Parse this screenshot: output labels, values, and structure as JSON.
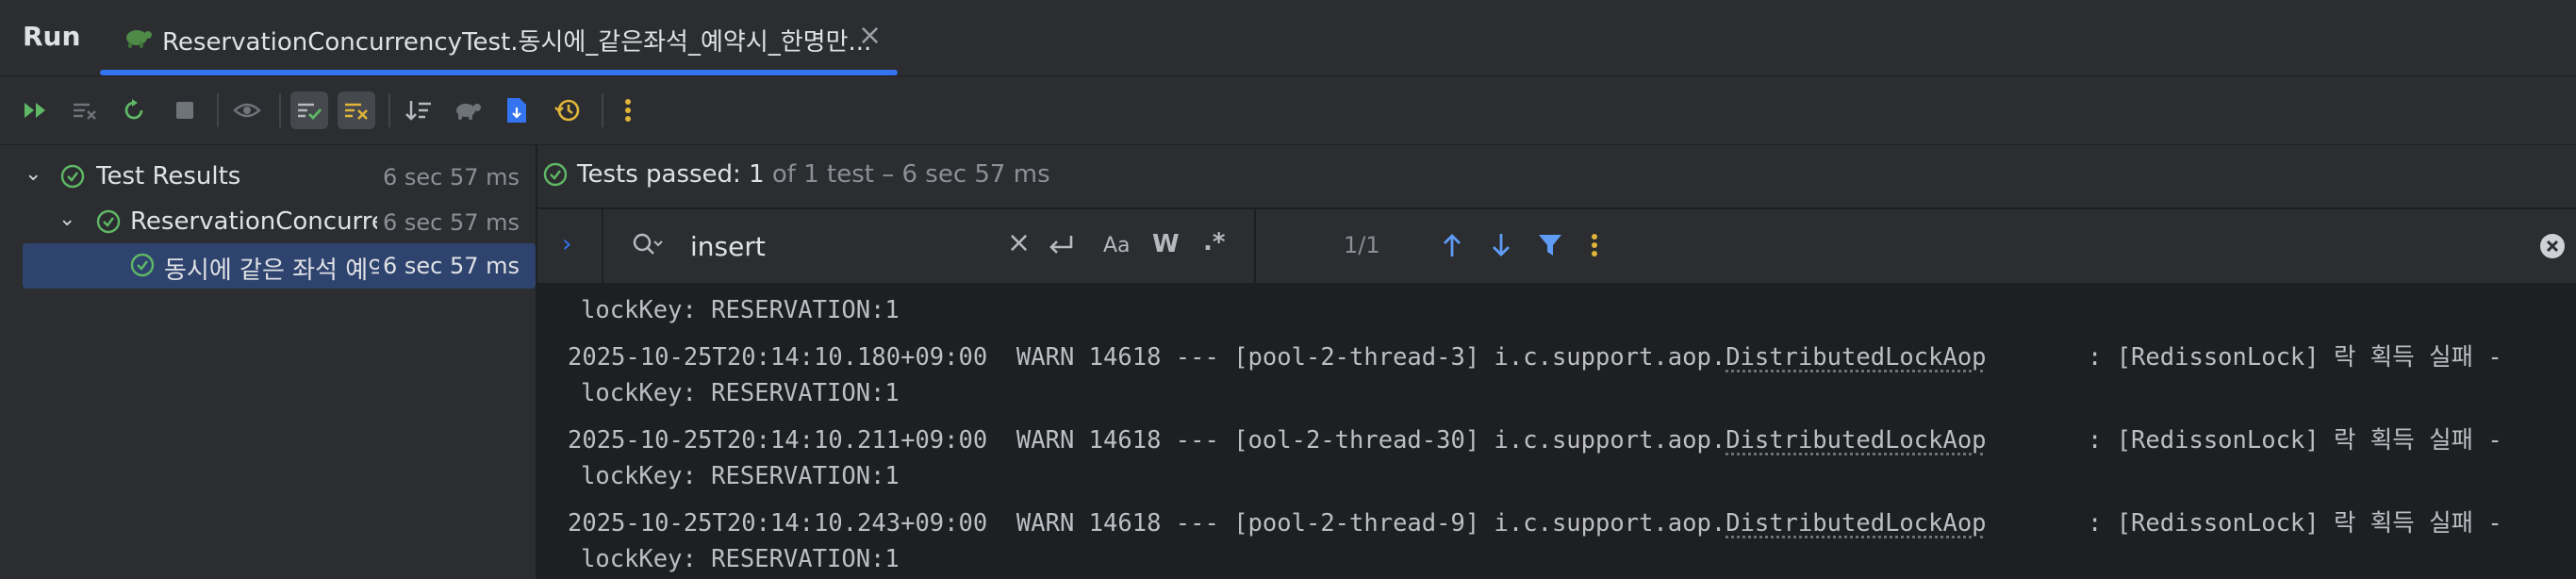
{
  "header": {
    "run_label": "Run",
    "tab_title": "ReservationConcurrencyTest.동시에_같은좌석_예약시_한명만...",
    "tab_close": "×"
  },
  "toolbar": {
    "buttons": [
      "rerun-failed-icon",
      "rerun-tests-icon",
      "toggle-auto-test-icon",
      "stop-icon",
      "show-passed-icon",
      "show-ignored-icon",
      "sort-icon",
      "collapse-icon",
      "export-icon",
      "history-icon",
      "more-icon"
    ]
  },
  "tree": {
    "root": {
      "label": "Test Results",
      "time": "6 sec 57 ms"
    },
    "class_node": {
      "label": "ReservationConcurrencyTest",
      "time": "6 sec 57 ms"
    },
    "method_node": {
      "label": "동시에 같은 좌석 예약시 한명만",
      "time": "6 sec 57 ms"
    }
  },
  "status": {
    "prefix": "Tests passed: ",
    "count": "1",
    "suffix": " of 1 test – 6 sec 57 ms"
  },
  "search": {
    "value": "insert",
    "clear": "×",
    "match_case": "Aa",
    "words": "W",
    "regex": ".*",
    "counter": "1/1"
  },
  "console": {
    "lines": [
      {
        "cont": true,
        "text": "lockKey: RESERVATION:1"
      },
      {
        "cont": false,
        "pre": "2025-10-25T20:14:10.180+09:00  WARN 14618 --- [pool-2-thread-3] i.c.support.aop.",
        "link": "DistributedLockAop",
        "post": "       : [RedissonLock] 락 획득 실패 -"
      },
      {
        "cont": true,
        "text": "lockKey: RESERVATION:1"
      },
      {
        "cont": false,
        "pre": "2025-10-25T20:14:10.211+09:00  WARN 14618 --- [ool-2-thread-30] i.c.support.aop.",
        "link": "DistributedLockAop",
        "post": "       : [RedissonLock] 락 획득 실패 -"
      },
      {
        "cont": true,
        "text": "lockKey: RESERVATION:1"
      },
      {
        "cont": false,
        "pre": "2025-10-25T20:14:10.243+09:00  WARN 14618 --- [pool-2-thread-9] i.c.support.aop.",
        "link": "DistributedLockAop",
        "post": "       : [RedissonLock] 락 획득 실패 -"
      },
      {
        "cont": true,
        "text": "lockKey: RESERVATION:1"
      }
    ]
  },
  "colors": {
    "accent": "#3574f0",
    "pass_green": "#5fb865",
    "warn_yellow": "#e0b539"
  }
}
